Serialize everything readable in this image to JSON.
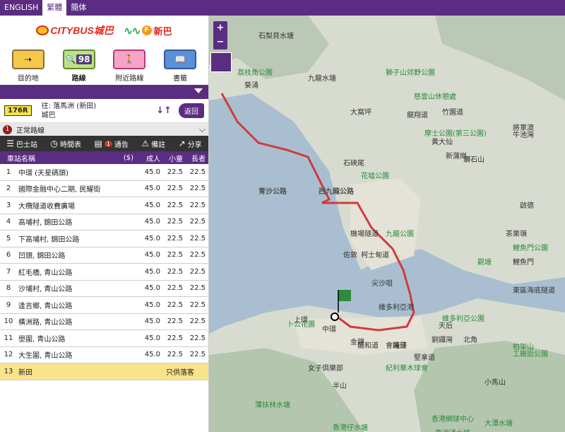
{
  "languages": [
    {
      "label": "ENGLISH"
    },
    {
      "label": "繁體",
      "active": true
    },
    {
      "label": "簡体"
    }
  ],
  "logos": {
    "citybus": "CITYBUS城巴",
    "firstbus": "新巴"
  },
  "nav": [
    {
      "label": "目的地",
      "icon": "destination-icon"
    },
    {
      "label": "路線",
      "icon": "route-search-icon",
      "badge": "98",
      "active": true
    },
    {
      "label": "附近路線",
      "icon": "nearby-walk-icon"
    },
    {
      "label": "書籤",
      "icon": "bookmark-book-icon"
    }
  ],
  "route": {
    "number": "176R",
    "dest_line1": "往: 落馬洲 (新田)",
    "dest_line2": "城巴",
    "swap_icon": "swap-arrows-icon",
    "back_label": "返回"
  },
  "variant": {
    "number": "1",
    "label": "正常路線"
  },
  "tools": [
    {
      "label": "巴士站",
      "icon": "bus-stop-list-icon"
    },
    {
      "label": "時間表",
      "icon": "clock-icon"
    },
    {
      "label": "通告",
      "icon": "notice-icon",
      "badge": "1"
    },
    {
      "label": "備註",
      "icon": "warning-icon"
    },
    {
      "label": "分享",
      "icon": "share-icon"
    }
  ],
  "table": {
    "headers": {
      "stop": "車站名稱",
      "currency": "($)",
      "adult": "成人",
      "child": "小童",
      "senior": "長者"
    },
    "rows": [
      {
        "idx": "1",
        "name": "中環 (天星碼頭)",
        "adult": "45.0",
        "child": "22.5",
        "senior": "22.5"
      },
      {
        "idx": "2",
        "name": "國際金融中心二期, 民耀街",
        "adult": "45.0",
        "child": "22.5",
        "senior": "22.5"
      },
      {
        "idx": "3",
        "name": "大欖隧道收費廣場",
        "adult": "45.0",
        "child": "22.5",
        "senior": "22.5"
      },
      {
        "idx": "4",
        "name": "高埔村, 錦田公路",
        "adult": "45.0",
        "child": "22.5",
        "senior": "22.5"
      },
      {
        "idx": "5",
        "name": "下高埔村, 錦田公路",
        "adult": "45.0",
        "child": "22.5",
        "senior": "22.5"
      },
      {
        "idx": "6",
        "name": "凹頭, 錦田公路",
        "adult": "45.0",
        "child": "22.5",
        "senior": "22.5"
      },
      {
        "idx": "7",
        "name": "紅毛橋, 青山公路",
        "adult": "45.0",
        "child": "22.5",
        "senior": "22.5"
      },
      {
        "idx": "8",
        "name": "沙埔村, 青山公路",
        "adult": "45.0",
        "child": "22.5",
        "senior": "22.5"
      },
      {
        "idx": "9",
        "name": "逢吉鄉, 青山公路",
        "adult": "45.0",
        "child": "22.5",
        "senior": "22.5"
      },
      {
        "idx": "10",
        "name": "橫洲路, 青山公路",
        "adult": "45.0",
        "child": "22.5",
        "senior": "22.5"
      },
      {
        "idx": "11",
        "name": "壆圍, 青山公路",
        "adult": "45.0",
        "child": "22.5",
        "senior": "22.5"
      },
      {
        "idx": "12",
        "name": "大生圍, 青山公路",
        "adult": "45.0",
        "child": "22.5",
        "senior": "22.5"
      }
    ],
    "last": {
      "idx": "13",
      "name": "新田",
      "note": "只供落客"
    }
  },
  "map": {
    "zoom_in": "+",
    "zoom_out": "−",
    "labels": [
      {
        "t": "荔枝角公園",
        "c": "green"
      },
      {
        "t": "九龍水塘"
      },
      {
        "t": "石梨貝水塘"
      },
      {
        "t": "獅子山郊野公園",
        "c": "green"
      },
      {
        "t": "慈雲山休憩處",
        "c": "green"
      },
      {
        "t": "大窩坪"
      },
      {
        "t": "龍翔道"
      },
      {
        "t": "竹園道"
      },
      {
        "t": "摩士公園(第三公園)",
        "c": "green"
      },
      {
        "t": "黃大仙"
      },
      {
        "t": "新蒲崗"
      },
      {
        "t": "石硤尾"
      },
      {
        "t": "花墟公園",
        "c": "green"
      },
      {
        "t": "葵涌"
      },
      {
        "t": "青沙公路",
        "c": "road"
      },
      {
        "t": "西九龍公路",
        "c": "road"
      },
      {
        "t": "機場隧道"
      },
      {
        "t": "佐敦"
      },
      {
        "t": "柯士甸道"
      },
      {
        "t": "尖沙咀"
      },
      {
        "t": "九龍公園",
        "c": "green"
      },
      {
        "t": "維多利亞港"
      },
      {
        "t": "啟德"
      },
      {
        "t": "觀塘",
        "c": "green"
      },
      {
        "t": "鯉魚門"
      },
      {
        "t": "東區海底隧道"
      },
      {
        "t": "中環"
      },
      {
        "t": "上環"
      },
      {
        "t": "卜公花園",
        "c": "green"
      },
      {
        "t": "金鐘"
      },
      {
        "t": "灣仔"
      },
      {
        "t": "銅鑼灣"
      },
      {
        "t": "天后"
      },
      {
        "t": "北角"
      },
      {
        "t": "龍和道"
      },
      {
        "t": "會議道"
      },
      {
        "t": "堅拿道"
      },
      {
        "t": "紀利華木球會",
        "c": "green"
      },
      {
        "t": "女子俱樂部"
      },
      {
        "t": "半山"
      },
      {
        "t": "薄扶林水塘",
        "c": "green"
      },
      {
        "t": "香港仔水塘",
        "c": "green"
      },
      {
        "t": "香港網球中心",
        "c": "green"
      },
      {
        "t": "大潭水塘",
        "c": "green"
      },
      {
        "t": "黃泥涌水塘",
        "c": "green"
      },
      {
        "t": "維多利亞公園",
        "c": "green"
      },
      {
        "t": "小馬山"
      },
      {
        "t": "柏架山",
        "c": "green"
      },
      {
        "t": "工廠街公園",
        "c": "green"
      },
      {
        "t": "將軍澳"
      },
      {
        "t": "鑽石山"
      },
      {
        "t": "牛池灣"
      },
      {
        "t": "茶果嶺"
      },
      {
        "t": "鯉魚門公園",
        "c": "green"
      }
    ]
  }
}
